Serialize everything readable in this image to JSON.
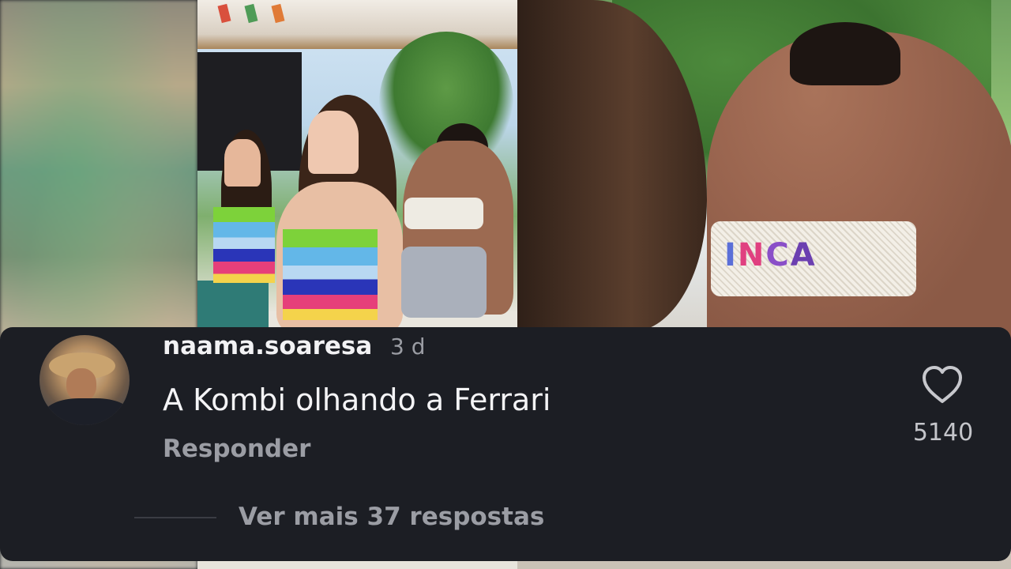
{
  "comment": {
    "username": "naama.soaresa",
    "time_ago": "3 d",
    "text": "A Kombi olhando a Ferrari",
    "reply_label": "Responder",
    "like_count": "5140",
    "more_replies_label": "Ver mais 37 respostas"
  },
  "icons": {
    "like": "heart-outline-icon",
    "avatar": "user-avatar"
  },
  "colors": {
    "card_background": "#1c1e24",
    "text_primary": "#f4f4f6",
    "text_secondary": "#9b9da4"
  }
}
